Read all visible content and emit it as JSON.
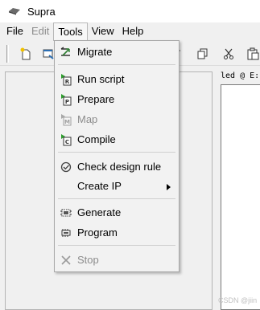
{
  "window": {
    "title": "Supra",
    "icon": "app-logo-icon"
  },
  "menubar": {
    "items": [
      {
        "label": "File",
        "disabled": false,
        "active": false
      },
      {
        "label": "Edit",
        "disabled": true,
        "active": false
      },
      {
        "label": "Tools",
        "disabled": false,
        "active": true
      },
      {
        "label": "View",
        "disabled": false,
        "active": false
      },
      {
        "label": "Help",
        "disabled": false,
        "active": false
      }
    ]
  },
  "toolbar": {
    "icons": [
      "new-file-icon",
      "open-project-icon",
      "paste-icon",
      "copy-icon",
      "cut-icon",
      "clipboard-icon"
    ]
  },
  "tools_menu": {
    "items": [
      {
        "label": "Migrate",
        "icon": "migrate-icon",
        "disabled": false
      },
      {
        "label": "Run script",
        "icon": "run-script-icon",
        "disabled": false
      },
      {
        "label": "Prepare",
        "icon": "prepare-icon",
        "disabled": false
      },
      {
        "label": "Map",
        "icon": "map-icon",
        "disabled": true
      },
      {
        "label": "Compile",
        "icon": "compile-icon",
        "disabled": false
      },
      {
        "label": "Check design rule",
        "icon": "check-icon",
        "disabled": false
      },
      {
        "label": "Create IP",
        "icon": "",
        "disabled": false,
        "submenu": true
      },
      {
        "label": "Generate",
        "icon": "generate-icon",
        "disabled": false
      },
      {
        "label": "Program",
        "icon": "program-icon",
        "disabled": false
      },
      {
        "label": "Stop",
        "icon": "stop-icon",
        "disabled": true
      }
    ]
  },
  "editor": {
    "path_label": "led @ E:"
  },
  "watermark": "CSDN @jiin"
}
